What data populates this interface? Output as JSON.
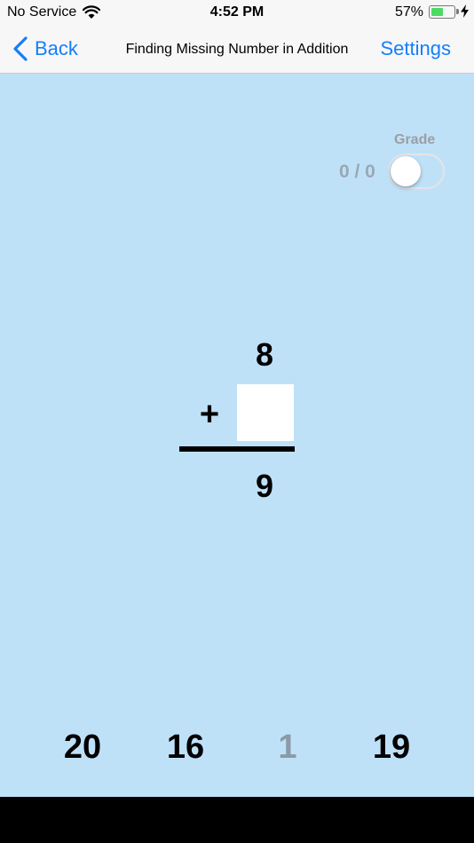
{
  "status_bar": {
    "carrier": "No Service",
    "time": "4:52 PM",
    "battery_percent": "57%",
    "battery_level": 0.57
  },
  "nav": {
    "back_label": "Back",
    "title": "Finding Missing Number in Addition",
    "settings_label": "Settings"
  },
  "grade": {
    "label": "Grade",
    "score": "0 / 0",
    "toggle_on": false
  },
  "problem": {
    "top_number": "8",
    "operator": "+",
    "sum": "9",
    "answer": ""
  },
  "choices": [
    "20",
    "16",
    "1",
    "19"
  ],
  "colors": {
    "background": "#bfe1f8",
    "accent": "#157efb",
    "dimmed_choice": "#8a9aa6"
  },
  "icons": {
    "back": "chevron-left-icon",
    "wifi": "wifi-icon",
    "battery": "battery-icon",
    "charging": "lightning-bolt-icon"
  }
}
